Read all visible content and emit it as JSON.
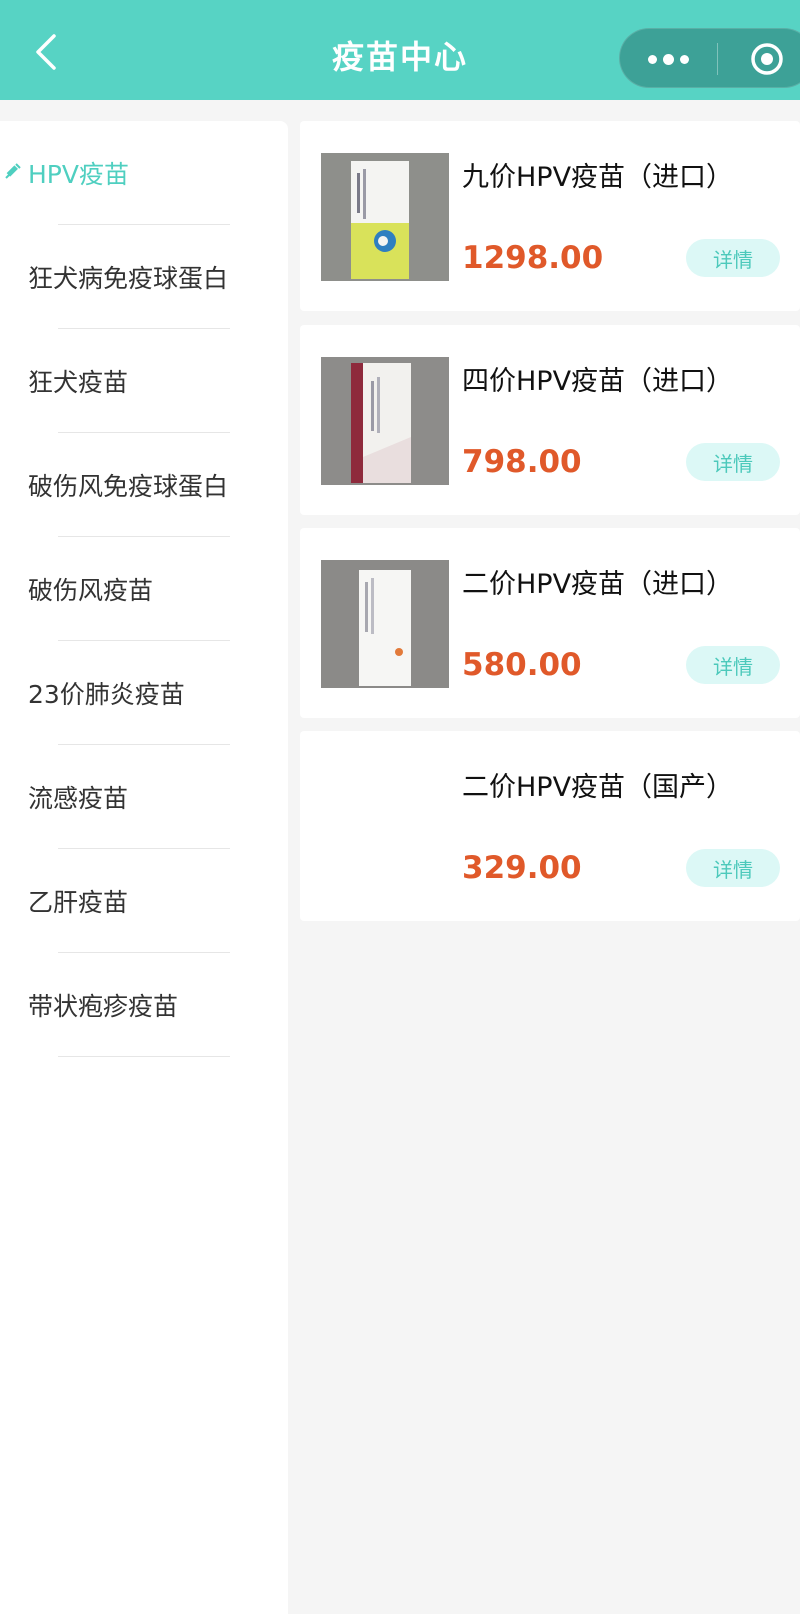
{
  "navbar": {
    "title": "疫苗中心"
  },
  "sidebar": {
    "items": [
      {
        "label": "HPV疫苗",
        "active": true
      },
      {
        "label": "狂犬病免疫球蛋白"
      },
      {
        "label": "狂犬疫苗"
      },
      {
        "label": "破伤风免疫球蛋白"
      },
      {
        "label": "破伤风疫苗"
      },
      {
        "label": "23价肺炎疫苗"
      },
      {
        "label": "流感疫苗"
      },
      {
        "label": "乙肝疫苗"
      },
      {
        "label": "带状疱疹疫苗"
      }
    ]
  },
  "products": [
    {
      "name": "九价HPV疫苗（进口）",
      "price": "1298.00",
      "detail_label": "详情",
      "has_image": true
    },
    {
      "name": "四价HPV疫苗（进口）",
      "price": "798.00",
      "detail_label": "详情",
      "has_image": true
    },
    {
      "name": "二价HPV疫苗（进口）",
      "price": "580.00",
      "detail_label": "详情",
      "has_image": true
    },
    {
      "name": "二价HPV疫苗（国产）",
      "price": "329.00",
      "detail_label": "详情",
      "has_image": false
    }
  ],
  "colors": {
    "primary": "#57d3c4",
    "active_text": "#4fcfc0",
    "price": "#e0592a",
    "detail_bg": "#dcf8f6"
  }
}
